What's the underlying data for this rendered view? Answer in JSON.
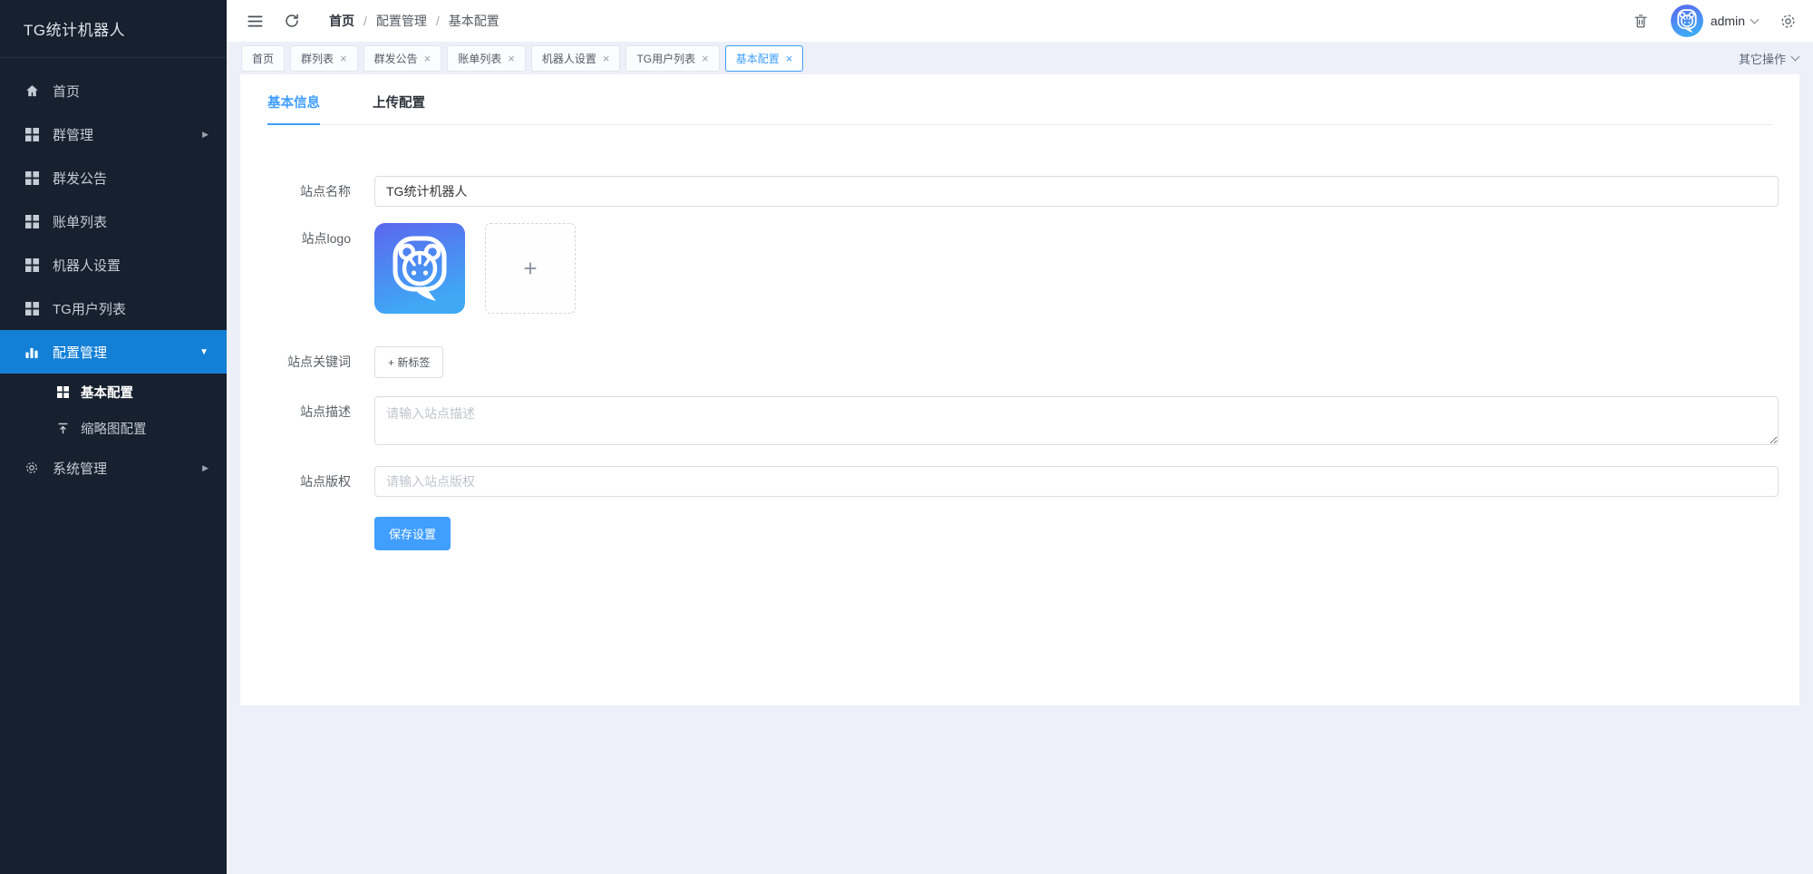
{
  "colors": {
    "accent": "#409eff",
    "sidebar_bg": "#16202e",
    "sidebar_active_bg": "#1380d6",
    "save_button": "#409eff",
    "logo_gradient_top": "#5b67ee",
    "logo_gradient_bottom": "#3fa9f5"
  },
  "glyphs": {
    "arrow_right": "▶",
    "arrow_down": "▼",
    "plus": "+",
    "close": "×",
    "breadcrumb_sep": "/"
  },
  "sidebar": {
    "title": "TG统计机器人",
    "items": [
      {
        "label": "首页",
        "icon": "home-icon"
      },
      {
        "label": "群管理",
        "icon": "grid-icon",
        "arrow": "right"
      },
      {
        "label": "群发公告",
        "icon": "grid-icon"
      },
      {
        "label": "账单列表",
        "icon": "grid-icon"
      },
      {
        "label": "机器人设置",
        "icon": "grid-icon"
      },
      {
        "label": "TG用户列表",
        "icon": "grid-icon"
      },
      {
        "label": "配置管理",
        "icon": "bar-chart-icon",
        "arrow": "down",
        "active": true
      },
      {
        "label": "基本配置",
        "icon": "grid-icon",
        "sub": true,
        "current": true
      },
      {
        "label": "缩略图配置",
        "icon": "upload-icon",
        "sub": true
      },
      {
        "label": "系统管理",
        "icon": "gear-icon",
        "arrow": "right"
      }
    ]
  },
  "header": {
    "breadcrumb": [
      "首页",
      "配置管理",
      "基本配置"
    ],
    "username": "admin"
  },
  "tabbar": {
    "tabs": [
      {
        "label": "首页",
        "closable": false
      },
      {
        "label": "群列表",
        "closable": true
      },
      {
        "label": "群发公告",
        "closable": true
      },
      {
        "label": "账单列表",
        "closable": true
      },
      {
        "label": "机器人设置",
        "closable": true
      },
      {
        "label": "TG用户列表",
        "closable": true
      },
      {
        "label": "基本配置",
        "closable": true,
        "active": true
      }
    ],
    "more_label": "其它操作"
  },
  "content": {
    "tabs": [
      {
        "label": "基本信息",
        "active": true
      },
      {
        "label": "上传配置"
      }
    ],
    "form": {
      "name": {
        "label": "站点名称",
        "value": "TG统计机器人"
      },
      "logo": {
        "label": "站点logo"
      },
      "keywords": {
        "label": "站点关键词",
        "add_tag": "+ 新标签"
      },
      "desc": {
        "label": "站点描述",
        "placeholder": "请输入站点描述"
      },
      "copyright": {
        "label": "站点版权",
        "placeholder": "请输入站点版权"
      },
      "save": "保存设置"
    }
  }
}
